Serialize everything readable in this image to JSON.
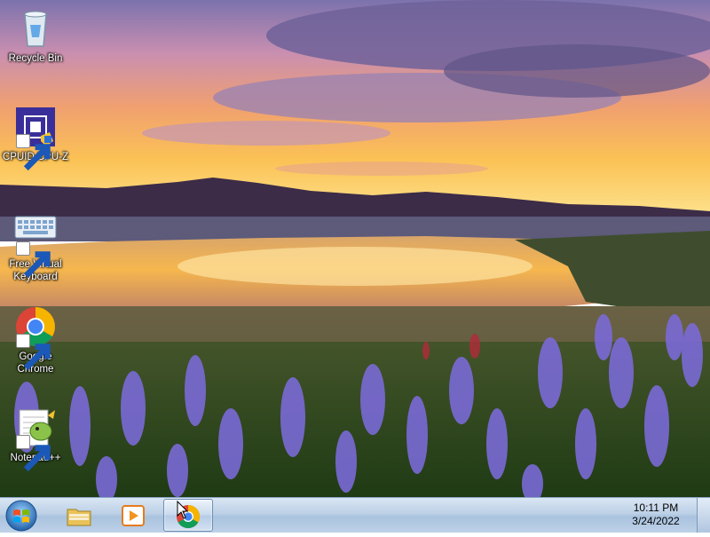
{
  "desktop": {
    "icons": [
      {
        "label": "Recycle Bin",
        "icon": "recycle-bin-icon"
      },
      {
        "label": "CPUID CPU-Z",
        "icon": "cpu-z-icon"
      },
      {
        "label": "Free Virtual Keyboard",
        "icon": "virtual-keyboard-icon"
      },
      {
        "label": "Google Chrome",
        "icon": "chrome-icon"
      },
      {
        "label": "Notepad++",
        "icon": "notepad-plus-plus-icon"
      }
    ]
  },
  "taskbar": {
    "pinned": [
      {
        "icon": "windows-explorer-icon"
      },
      {
        "icon": "media-player-icon"
      },
      {
        "icon": "chrome-icon",
        "active": true
      }
    ],
    "clock": {
      "time": "10:11 PM",
      "date": "3/24/2022"
    }
  },
  "colors": {
    "taskbar": "#bcd0e6",
    "sky_top": "#8a7fb3",
    "sunset": "#f7b84b"
  }
}
